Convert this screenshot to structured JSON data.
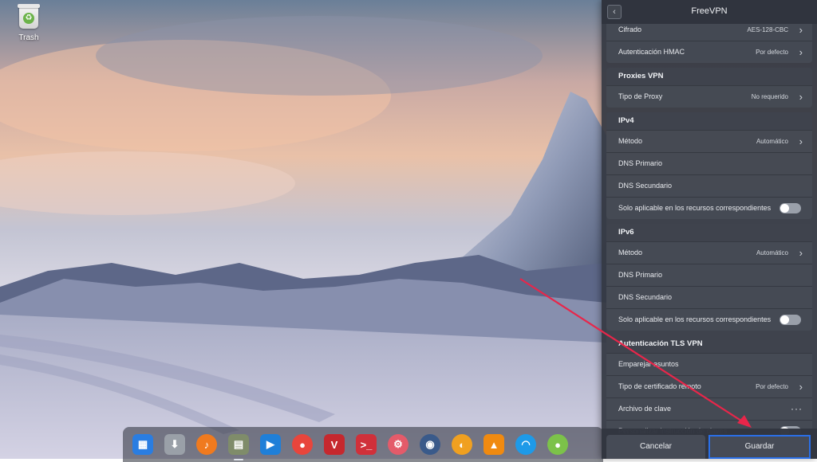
{
  "desktop": {
    "trash_label": "Trash"
  },
  "dock": {
    "items": [
      {
        "icon": "launcher-icon",
        "color": "#2a7de1"
      },
      {
        "icon": "store-icon",
        "color": "#9aa0a8"
      },
      {
        "icon": "music-icon",
        "color": "#f07a1e"
      },
      {
        "icon": "files-icon",
        "color": "#7f8c6a"
      },
      {
        "icon": "video-icon",
        "color": "#1f7fd8"
      },
      {
        "icon": "chrome-icon",
        "color": "#e8453c"
      },
      {
        "icon": "vivaldi-icon",
        "color": "#c6282e"
      },
      {
        "icon": "terminal-icon",
        "color": "#d0303a"
      },
      {
        "icon": "settings-icon",
        "color": "#e45b6a"
      },
      {
        "icon": "camera-icon",
        "color": "#3a5a8a"
      },
      {
        "icon": "deepin-clone-icon",
        "color": "#f0a020"
      },
      {
        "icon": "vlc-icon",
        "color": "#f08a10"
      },
      {
        "icon": "wifi-icon",
        "color": "#1e9ae8"
      },
      {
        "icon": "app-icon",
        "color": "#7cc24a"
      }
    ]
  },
  "panel": {
    "title": "FreeVPN",
    "groups": [
      {
        "header": "",
        "rows": [
          {
            "label": "Cifrado",
            "value": "AES-128-CBC",
            "control": "chevron"
          },
          {
            "label": "Autenticación HMAC",
            "value": "Por defecto",
            "control": "chevron"
          }
        ]
      },
      {
        "header": "Proxies VPN",
        "rows": [
          {
            "label": "Tipo de Proxy",
            "value": "No requerido",
            "control": "chevron"
          }
        ]
      },
      {
        "header": "IPv4",
        "rows": [
          {
            "label": "Método",
            "value": "Automático",
            "control": "chevron"
          },
          {
            "label": "DNS Primario",
            "value": "",
            "control": "none"
          },
          {
            "label": "DNS Secundario",
            "value": "",
            "control": "none"
          },
          {
            "label": "Solo aplicable en los recursos correspondientes",
            "value": "",
            "control": "toggle"
          }
        ]
      },
      {
        "header": "IPv6",
        "rows": [
          {
            "label": "Método",
            "value": "Automático",
            "control": "chevron"
          },
          {
            "label": "DNS Primario",
            "value": "",
            "control": "none"
          },
          {
            "label": "DNS Secundario",
            "value": "",
            "control": "none"
          },
          {
            "label": "Solo aplicable en los recursos correspondientes",
            "value": "",
            "control": "toggle"
          }
        ]
      },
      {
        "header": "Autenticación TLS VPN",
        "rows": [
          {
            "label": "Emparejar asuntos",
            "value": "",
            "control": "none"
          },
          {
            "label": "Tipo de certificado remoto",
            "value": "Por defecto",
            "control": "chevron"
          },
          {
            "label": "Archivo de clave",
            "value": "",
            "control": "dots"
          },
          {
            "label": "Personalizar instrucción de claves",
            "value": "",
            "control": "toggle"
          }
        ]
      }
    ],
    "cancel_label": "Cancelar",
    "save_label": "Guardar"
  },
  "colors": {
    "annotation_arrow": "#e8264a",
    "highlight_box": "#2a6fe8"
  }
}
